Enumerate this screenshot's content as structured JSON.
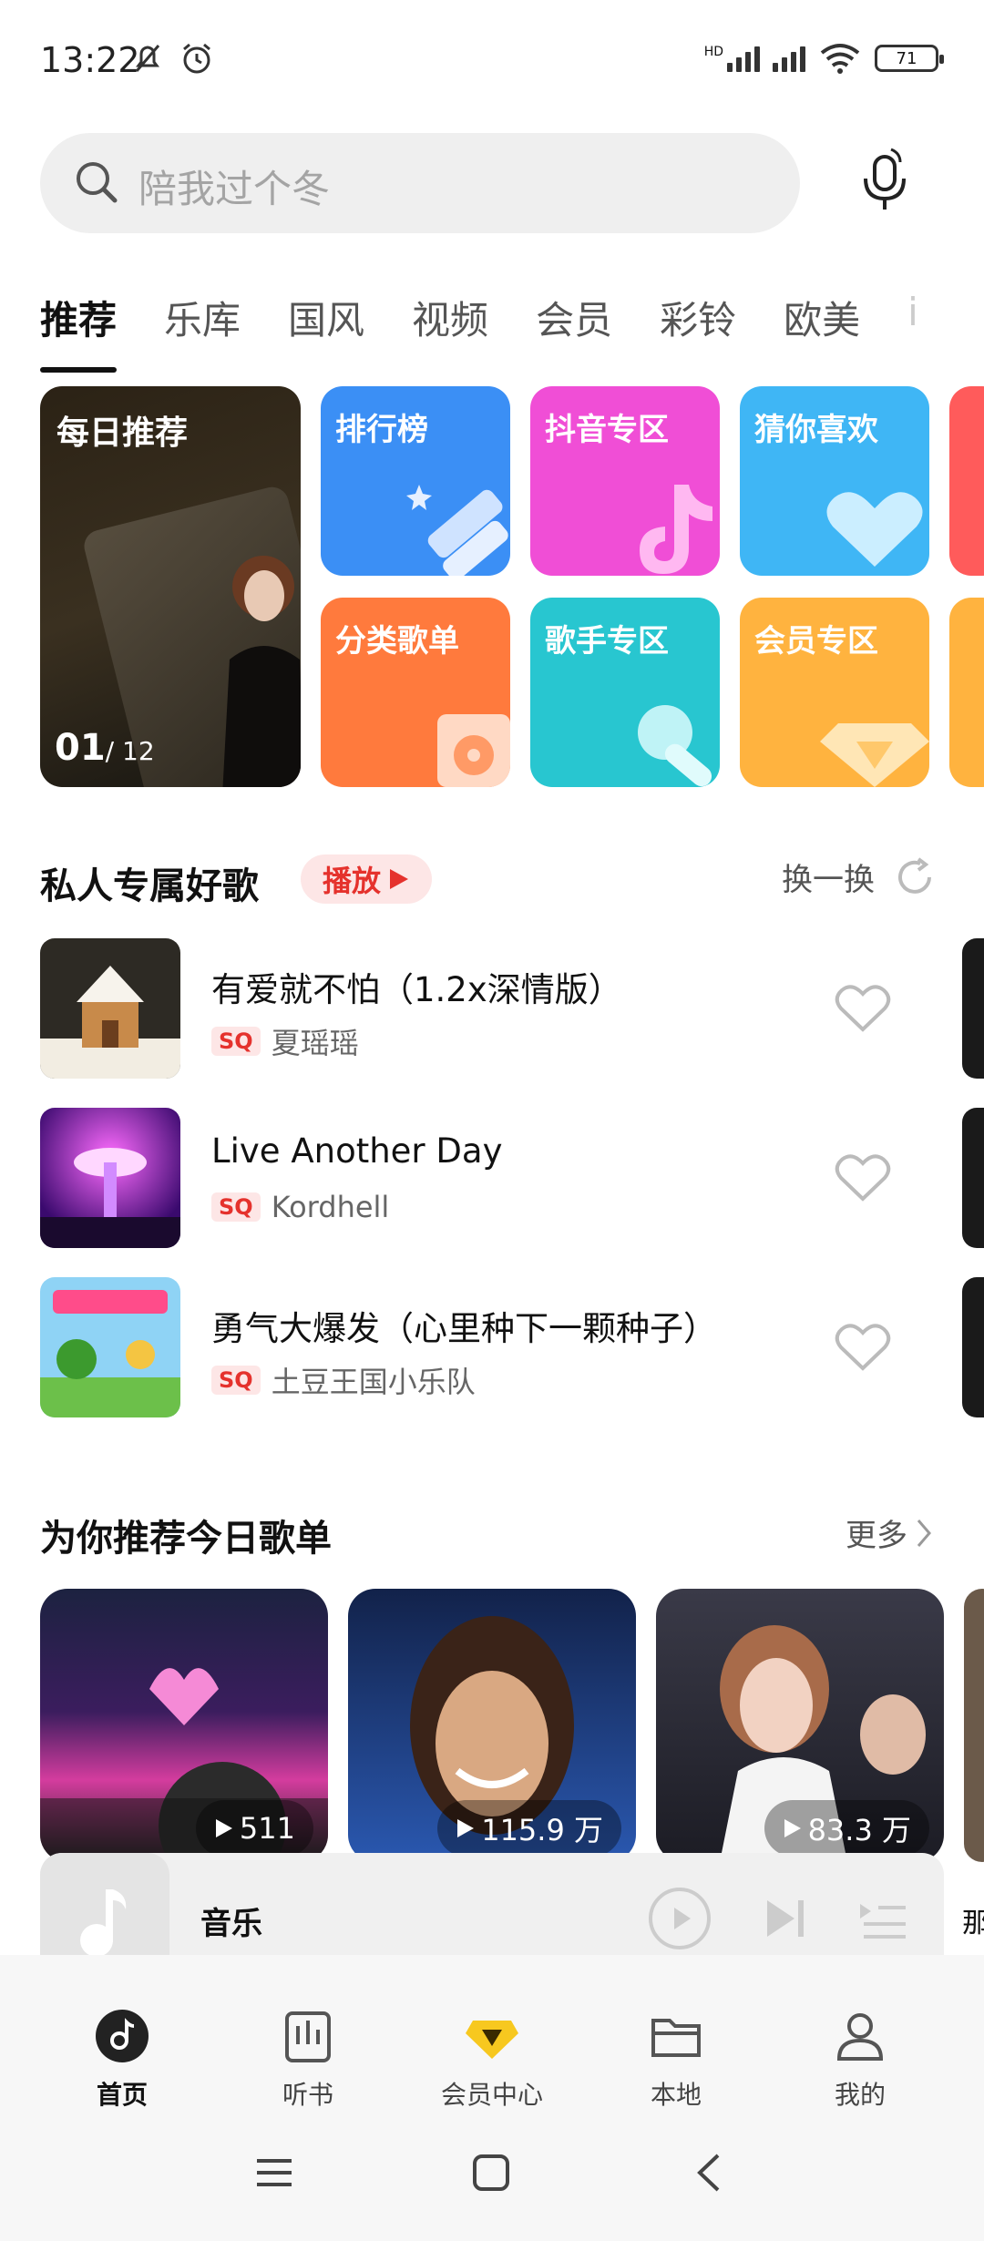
{
  "status": {
    "time": "13:22",
    "battery": "71",
    "network_label": "HD"
  },
  "search": {
    "placeholder": "陪我过个冬"
  },
  "tabs": [
    {
      "label": "推荐"
    },
    {
      "label": "乐库"
    },
    {
      "label": "国风"
    },
    {
      "label": "视频"
    },
    {
      "label": "会员"
    },
    {
      "label": "彩铃"
    },
    {
      "label": "欧美"
    },
    {
      "label": "i"
    }
  ],
  "daily": {
    "title": "每日推荐",
    "current": "01",
    "total": "/ 12"
  },
  "tiles": [
    {
      "label": "排行榜",
      "color": "#3b8ff5"
    },
    {
      "label": "抖音专区",
      "color": "#f04ed6"
    },
    {
      "label": "猜你喜欢",
      "color": "#3fb6f5"
    },
    {
      "label": "分类歌单",
      "color": "#ff7a3d"
    },
    {
      "label": "歌手专区",
      "color": "#28c6d0"
    },
    {
      "label": "会员专区",
      "color": "#ffb33f"
    }
  ],
  "private_section": {
    "title": "私人专属好歌",
    "play_label": "播放",
    "refresh_label": "换一换"
  },
  "songs": [
    {
      "name": "有爱就不怕（1.2x深情版）",
      "quality": "SQ",
      "artist": "夏瑶瑶"
    },
    {
      "name": "Live Another Day",
      "quality": "SQ",
      "artist": "Kordhell"
    },
    {
      "name": "勇气大爆发（心里种下一颗种子）",
      "quality": "SQ",
      "artist": "土豆王国小乐队"
    }
  ],
  "playlist_section": {
    "title": "为你推荐今日歌单",
    "more_label": "更多"
  },
  "playlists": [
    {
      "count": "511"
    },
    {
      "count": "115.9 万"
    },
    {
      "count": "83.3 万"
    }
  ],
  "player": {
    "title": "音乐",
    "edge_text": "那"
  },
  "nav": [
    {
      "label": "首页"
    },
    {
      "label": "听书"
    },
    {
      "label": "会员中心"
    },
    {
      "label": "本地"
    },
    {
      "label": "我的"
    }
  ],
  "colors": {
    "accent": "#e5322d"
  }
}
